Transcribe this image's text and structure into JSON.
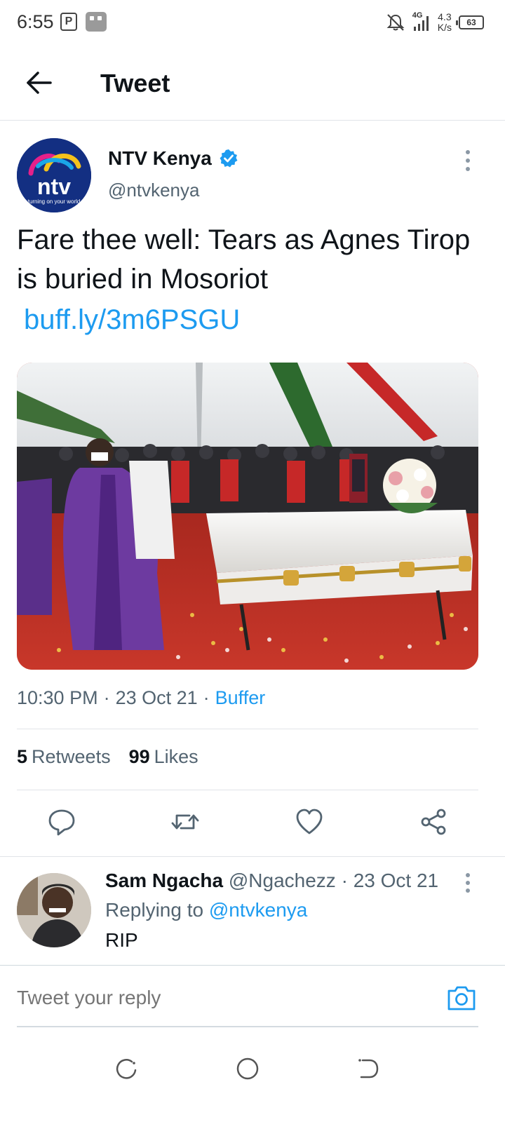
{
  "status_bar": {
    "time": "6:55",
    "p_icon_label": "P",
    "network": "4G",
    "speed_value": "4.3",
    "speed_unit": "K/s",
    "battery": "63"
  },
  "header": {
    "title": "Tweet"
  },
  "tweet": {
    "author_name": "NTV Kenya",
    "author_handle": "@ntvkenya",
    "avatar_logo_text": "ntv",
    "avatar_tagline": "turning on your world",
    "text": "Fare thee well: Tears as Agnes Tirop is buried in Mosoriot",
    "link": "buff.ly/3m6PSGU",
    "time": "10:30 PM",
    "date": "23 Oct 21",
    "source": "Buffer",
    "retweets_count": "5",
    "retweets_label": "Retweets",
    "likes_count": "99",
    "likes_label": "Likes"
  },
  "reply": {
    "name": "Sam Ngacha",
    "handle": "@Ngachezz",
    "date": "23 Oct 21",
    "replying_prefix": "Replying to",
    "replying_handle": "@ntvkenya",
    "text": "RIP"
  },
  "compose": {
    "placeholder": "Tweet your reply"
  },
  "colors": {
    "accent": "#1d9bf0",
    "text_primary": "#0f1419",
    "text_secondary": "#536471",
    "ntv_navy": "#132f82"
  }
}
